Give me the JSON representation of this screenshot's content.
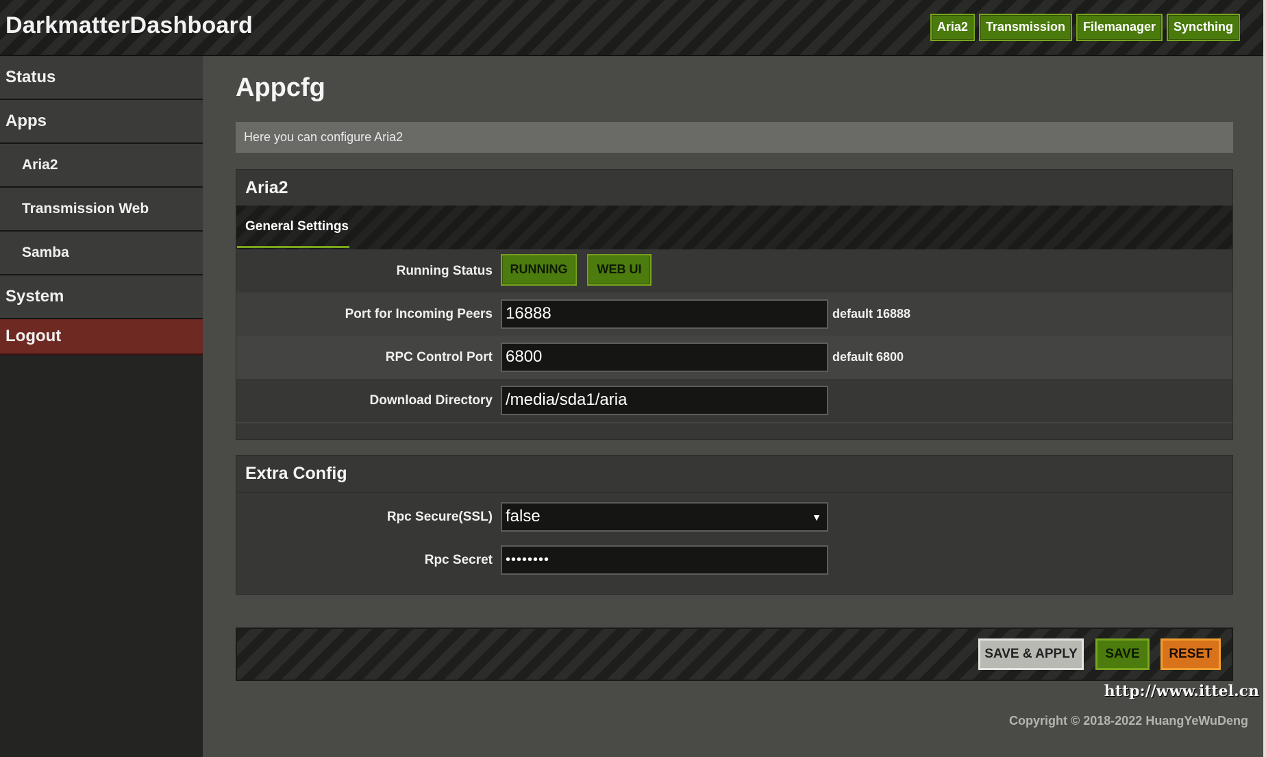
{
  "header": {
    "brand": "DarkmatterDashboard",
    "nav": [
      "Aria2",
      "Transmission",
      "Filemanager",
      "Syncthing"
    ]
  },
  "sidebar": {
    "status": "Status",
    "apps": "Apps",
    "apps_items": [
      "Aria2",
      "Transmission Web",
      "Samba"
    ],
    "system": "System",
    "logout": "Logout"
  },
  "main": {
    "title": "Appcfg",
    "description": "Here you can configure Aria2",
    "aria2_panel": {
      "title": "Aria2",
      "tab": "General Settings",
      "running_status_label": "Running Status",
      "running_button": "RUNNING",
      "webui_button": "WEB UI",
      "port_label": "Port for Incoming Peers",
      "port_value": "16888",
      "port_hint": "default 16888",
      "rpc_port_label": "RPC Control Port",
      "rpc_port_value": "6800",
      "rpc_port_hint": "default 6800",
      "download_dir_label": "Download Directory",
      "download_dir_value": "/media/sda1/aria"
    },
    "extra_panel": {
      "title": "Extra Config",
      "rpc_secure_label": "Rpc Secure(SSL)",
      "rpc_secure_value": "false",
      "rpc_secret_label": "Rpc Secret",
      "rpc_secret_value": "••••••••"
    },
    "actions": {
      "save_apply": "SAVE & APPLY",
      "save": "SAVE",
      "reset": "RESET"
    },
    "copyright": "Copyright © 2018-2022 HuangYeWuDeng"
  },
  "watermark": "http://www.ittel.cn",
  "colors": {
    "accent_green": "#4c7c0d",
    "logout_red": "#6e2a22",
    "reset_orange": "#d8731c"
  }
}
